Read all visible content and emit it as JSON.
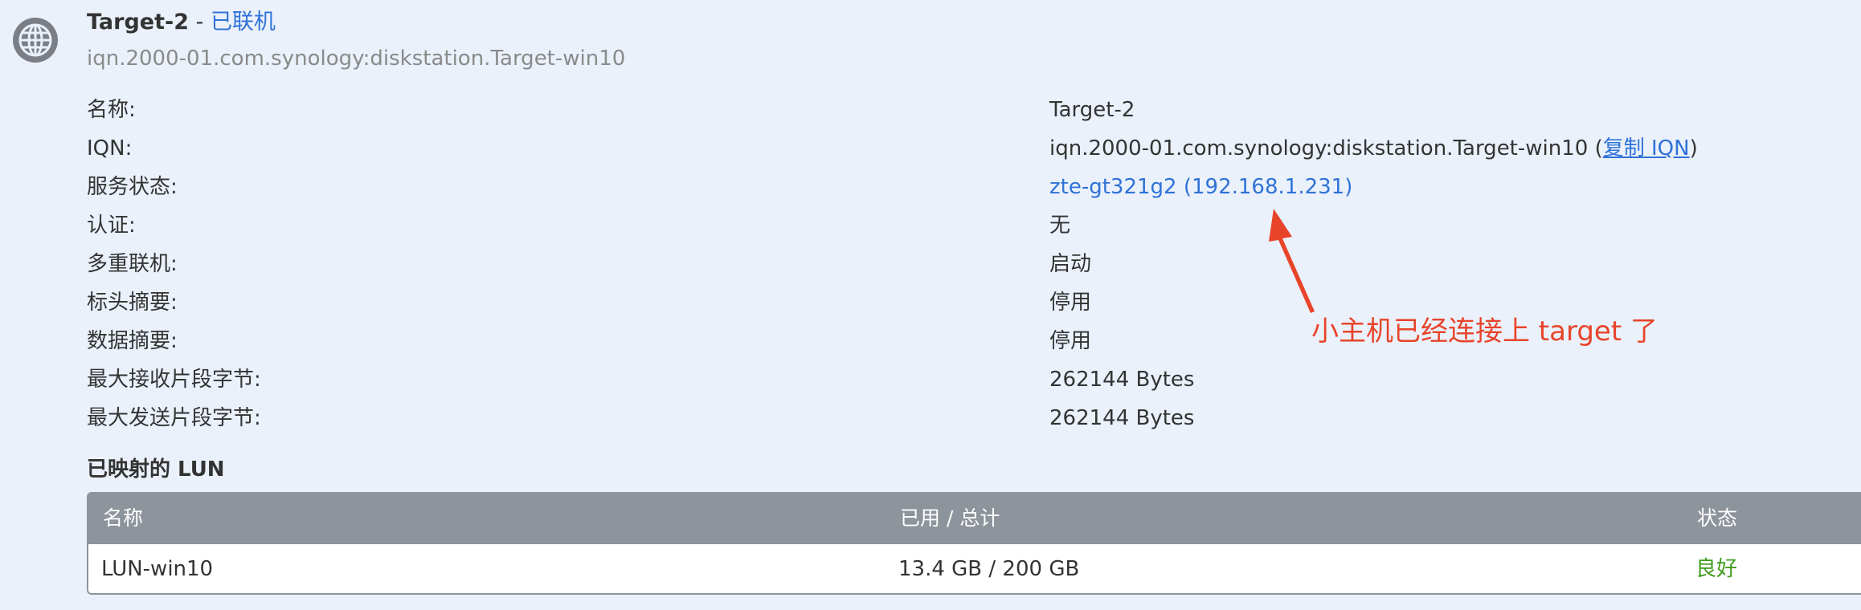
{
  "header": {
    "target_name": "Target-2",
    "separator": " - ",
    "connection_status": "已联机",
    "iqn": "iqn.2000-01.com.synology:diskstation.Target-win10"
  },
  "properties": [
    {
      "label": "名称:",
      "value": "Target-2"
    },
    {
      "label": "IQN:",
      "value": "iqn.2000-01.com.synology:diskstation.Target-win10 (",
      "link": "复制 IQN",
      "suffix": ")"
    },
    {
      "label": "服务状态:",
      "value": "zte-gt321g2 (192.168.1.231)"
    },
    {
      "label": "认证:",
      "value": "无"
    },
    {
      "label": "多重联机:",
      "value": "启动"
    },
    {
      "label": "标头摘要:",
      "value": "停用"
    },
    {
      "label": "数据摘要:",
      "value": "停用"
    },
    {
      "label": "最大接收片段字节:",
      "value": "262144 Bytes"
    },
    {
      "label": "最大发送片段字节:",
      "value": "262144 Bytes"
    }
  ],
  "annotation": {
    "text": "小主机已经连接上 target 了",
    "color": "#e8442a"
  },
  "lun_section": {
    "heading": "已映射的 LUN",
    "columns": [
      "名称",
      "已用 / 总计",
      "状态"
    ],
    "rows": [
      {
        "name": "LUN-win10",
        "usage": "13.4 GB / 200 GB",
        "status": "良好"
      }
    ]
  },
  "colors": {
    "background": "#eaf1fb",
    "link": "#2f72d8",
    "status_ok": "#3f9b1e",
    "table_header": "#8e949c",
    "annotation": "#e8442a"
  },
  "icons": {
    "target": "globe-icon",
    "arrow": "annotation-arrow"
  }
}
